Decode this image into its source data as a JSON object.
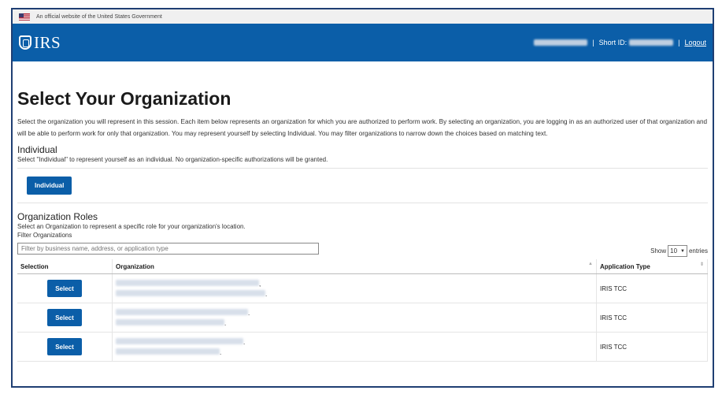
{
  "banner": {
    "text": "An official website of the United States Government"
  },
  "header": {
    "logo": "IRS",
    "short_id_label": "Short ID:",
    "logout": "Logout",
    "separator": "|"
  },
  "page": {
    "title": "Select Your Organization",
    "description": "Select the organization you will represent in this session. Each item below represents an organization for which you are authorized to perform work. By selecting an organization, you are logging in as an authorized user of that organization and will be able to perform work for only that organization. You may represent yourself by selecting Individual. You may filter organizations to narrow down the choices based on matching text."
  },
  "individual": {
    "heading": "Individual",
    "subtext": "Select \"Individual\" to represent yourself as an individual. No organization-specific authorizations will be granted.",
    "button": "Individual"
  },
  "org_roles": {
    "heading": "Organization Roles",
    "subtext": "Select an Organization to represent a specific role for your organization's location.",
    "filter_label": "Filter Organizations",
    "filter_placeholder": "Filter by business name, address, or application type",
    "show_label": "Show",
    "show_value": "10",
    "entries_label": "entries",
    "columns": {
      "selection": "Selection",
      "organization": "Organization",
      "application_type": "Application Type"
    },
    "rows": [
      {
        "button": "Select",
        "app_type": "IRIS TCC",
        "org_line1_suffix": ",",
        "org_line2_suffix": "."
      },
      {
        "button": "Select",
        "app_type": "IRIS TCC",
        "org_line1_suffix": ".",
        "org_line2_suffix": "."
      },
      {
        "button": "Select",
        "app_type": "IRIS TCC",
        "org_line1_suffix": ".",
        "org_line2_suffix": "."
      }
    ]
  }
}
